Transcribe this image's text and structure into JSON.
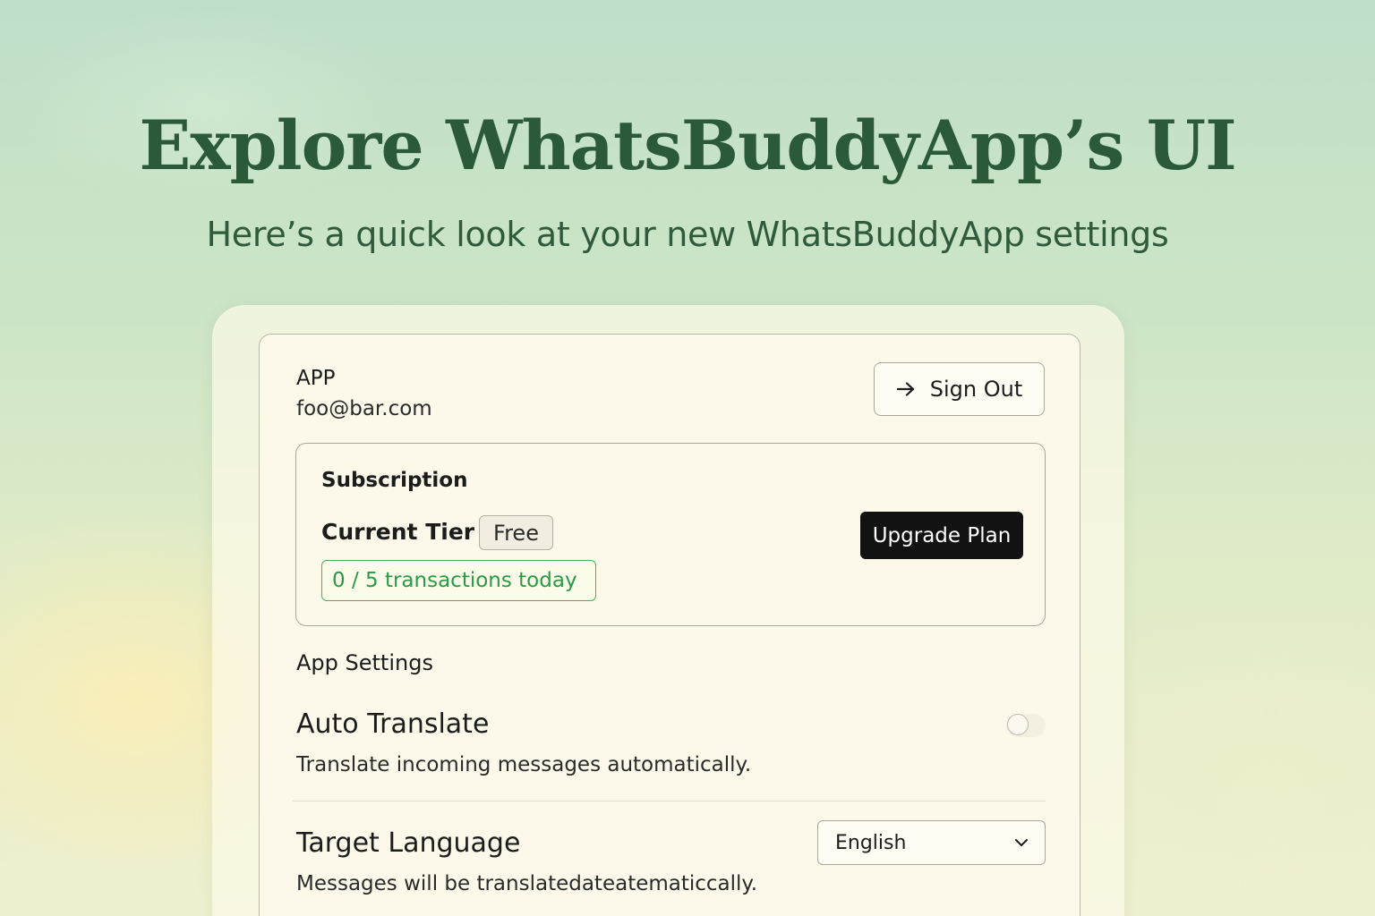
{
  "hero": {
    "title": "Explore WhatsBuddyApp’s UI",
    "subtitle": "Here’s a quick look at your new WhatsBuddyApp settings"
  },
  "account": {
    "app_label": "APP",
    "email": "foo@bar.com",
    "sign_out_label": "Sign Out",
    "sign_out_icon": "arrow-right-icon"
  },
  "subscription": {
    "title": "Subscription",
    "tier_label": "Current Tier",
    "tier_value": "Free",
    "usage_text": "0 / 5 transactions today",
    "upgrade_label": "Upgrade Plan",
    "usage_color": "#2a9a44"
  },
  "app_settings": {
    "heading": "App Settings",
    "auto_translate": {
      "title": "Auto Translate",
      "description": "Translate incoming messages automatically.",
      "enabled": false
    },
    "target_language": {
      "title": "Target Language",
      "description": "Messages will be translatedateatematiccally.",
      "selected": "English",
      "icon": "chevron-down-icon"
    }
  },
  "colors": {
    "title_green": "#2a5a3a",
    "card_bg": "#fdf9ea",
    "button_dark": "#121212"
  }
}
